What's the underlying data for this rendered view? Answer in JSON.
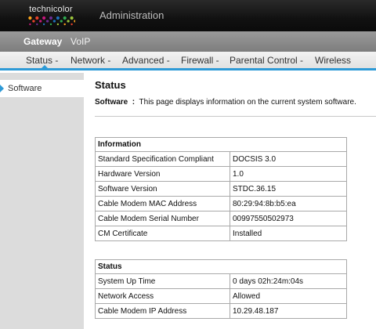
{
  "header": {
    "brand": "technicolor",
    "title": "Administration",
    "logo_colors": [
      "#f7a21b",
      "#e8412c",
      "#c2177a",
      "#6a2c91",
      "#1e6fb8",
      "#2fa84f",
      "#9bc43c"
    ]
  },
  "top_nav": {
    "gateway": "Gateway",
    "voip": "VoIP"
  },
  "tabs": [
    {
      "label": "Status -"
    },
    {
      "label": "Network -"
    },
    {
      "label": "Advanced -"
    },
    {
      "label": "Firewall -"
    },
    {
      "label": "Parental Control -"
    },
    {
      "label": "Wireless"
    }
  ],
  "sidebar": {
    "items": [
      {
        "label": "Software"
      }
    ]
  },
  "main": {
    "title": "Status",
    "desc_label": "Software",
    "desc_sep": ":",
    "desc_text": "This page displays information on the current system software."
  },
  "info_table": {
    "header": "Information",
    "rows": [
      {
        "label": "Standard Specification Compliant",
        "value": "DOCSIS 3.0"
      },
      {
        "label": "Hardware Version",
        "value": "1.0"
      },
      {
        "label": "Software Version",
        "value": "STDC.36.15"
      },
      {
        "label": "Cable Modem MAC Address",
        "value": "80:29:94:8b:b5:ea"
      },
      {
        "label": "Cable Modem Serial Number",
        "value": "00997550502973"
      },
      {
        "label": "CM Certificate",
        "value": "Installed"
      }
    ]
  },
  "status_table": {
    "header": "Status",
    "rows": [
      {
        "label": "System Up Time",
        "value": "0 days 02h:24m:04s"
      },
      {
        "label": "Network Access",
        "value": "Allowed"
      },
      {
        "label": "Cable Modem IP Address",
        "value": "10.29.48.187"
      }
    ]
  }
}
